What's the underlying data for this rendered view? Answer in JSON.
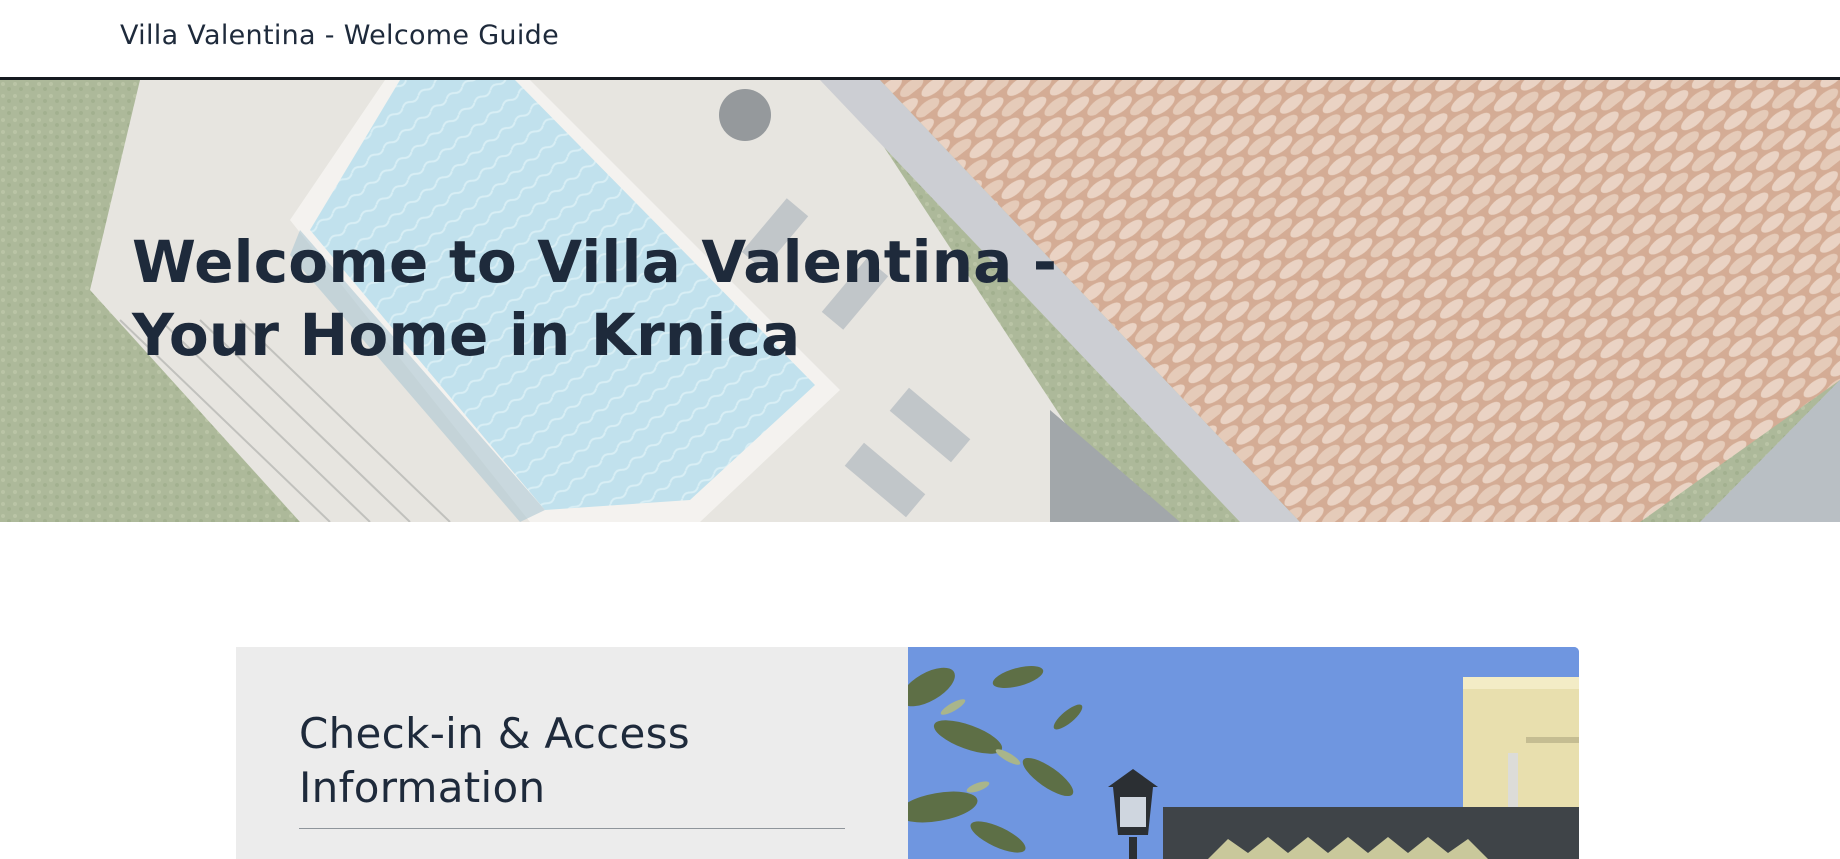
{
  "header": {
    "title": "Villa Valentina - Welcome Guide"
  },
  "hero": {
    "heading": "Welcome to Villa Valentina - Your Home in Krnica",
    "image_subject": "aerial view of pool, terrace with sun loungers and terracotta tile roof"
  },
  "section": {
    "card_title": "Check-in & Access Information",
    "image_subject": "villa exterior with olive tree, lantern and awning under blue sky"
  },
  "colors": {
    "text": "#1e2a3b",
    "header_border": "#151a20",
    "card_background": "#ececec",
    "sky": "#6f96e0",
    "pool": "#a9d6e6",
    "roof": "#c99676"
  }
}
